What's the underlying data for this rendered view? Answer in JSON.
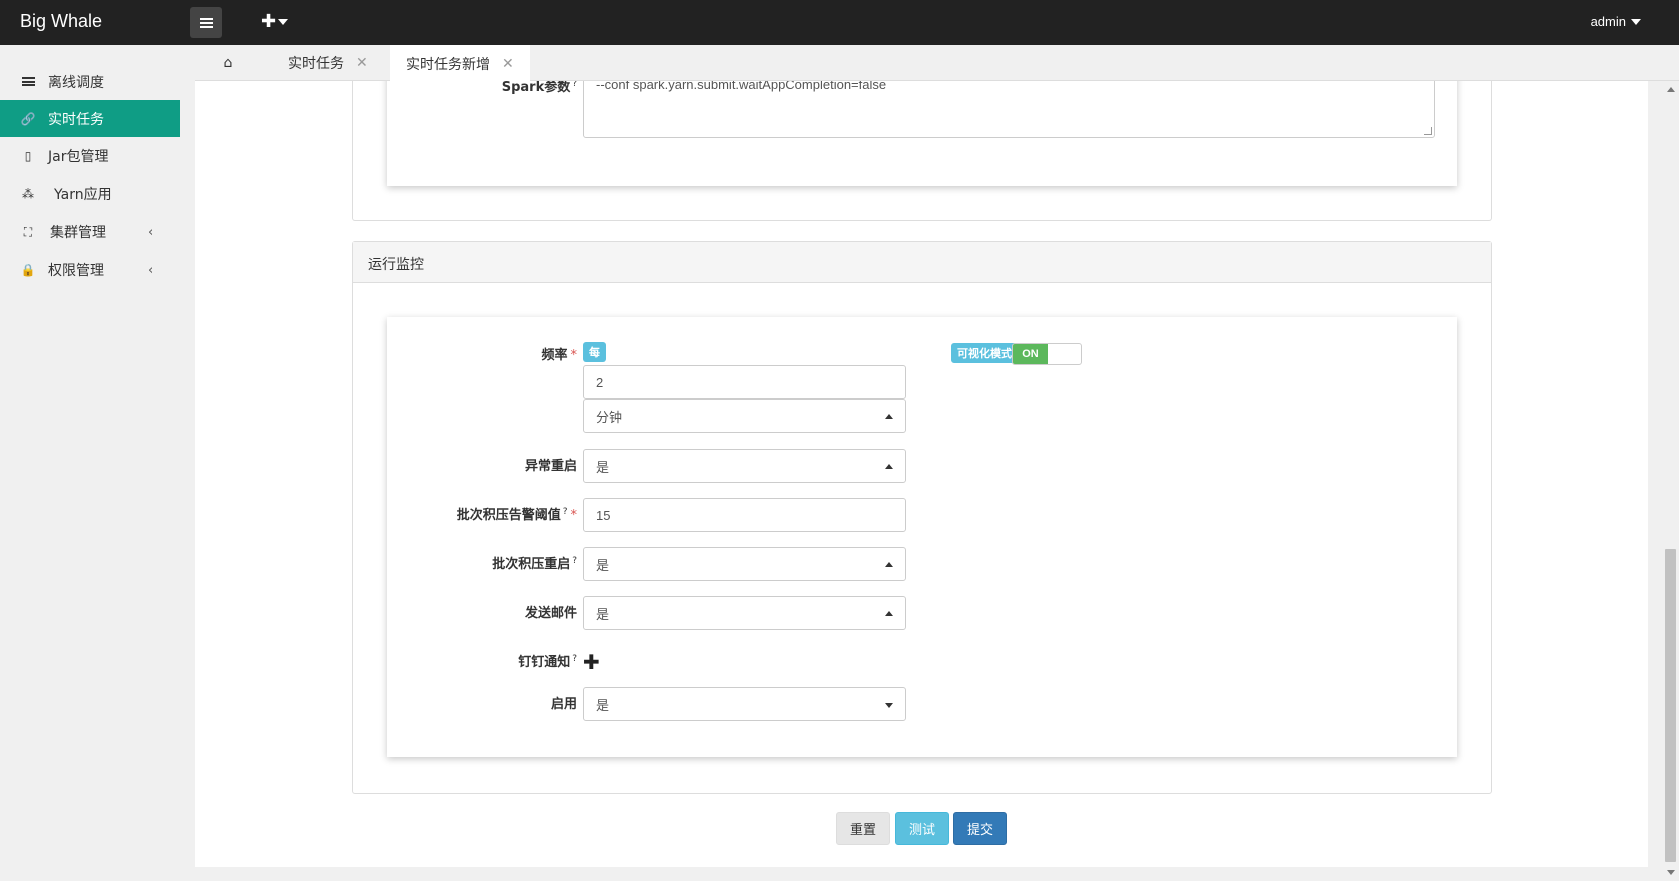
{
  "app": {
    "title": "Big Whale"
  },
  "topbar": {
    "user": "admin"
  },
  "sidebar": {
    "items": [
      {
        "label": "离线调度",
        "icon": "list-icon",
        "active": false
      },
      {
        "label": "实时任务",
        "icon": "link-icon",
        "active": true
      },
      {
        "label": "Jar包管理",
        "icon": "file-icon",
        "active": false
      },
      {
        "label": "Yarn应用",
        "icon": "cubes-icon",
        "active": false
      },
      {
        "label": "集群管理",
        "icon": "cluster-icon",
        "active": false,
        "expandable": true
      },
      {
        "label": "权限管理",
        "icon": "lock-icon",
        "active": false,
        "expandable": true
      }
    ]
  },
  "tabs": [
    {
      "label": "实时任务",
      "closable": true
    },
    {
      "label": "实时任务新增",
      "closable": true,
      "active": true
    }
  ],
  "form": {
    "spark_params": {
      "label": "Spark参数",
      "help": "?",
      "value": "--conf spark.yarn.submit.waitAppCompletion=false"
    },
    "monitor_section": {
      "title": "运行监控"
    },
    "frequency": {
      "label": "频率",
      "required": "*",
      "every_badge": "每",
      "value": "2",
      "unit": "分钟",
      "visual_mode_badge": "可视化模式",
      "toggle": "ON"
    },
    "restart_on_error": {
      "label": "异常重启",
      "value": "是"
    },
    "backlog_threshold": {
      "label": "批次积压告警阈值",
      "help": "?",
      "required": "*",
      "value": "15"
    },
    "backlog_restart": {
      "label": "批次积压重启",
      "help": "?",
      "value": "是"
    },
    "send_email": {
      "label": "发送邮件",
      "value": "是"
    },
    "dingtalk": {
      "label": "钉钉通知",
      "help": "?"
    },
    "enabled": {
      "label": "启用",
      "value": "是"
    }
  },
  "buttons": {
    "reset": "重置",
    "test": "测试",
    "submit": "提交"
  },
  "colors": {
    "primary": "#337ab7",
    "info": "#5bc0de",
    "success": "#5cb85c",
    "active_nav": "#0f9d85",
    "danger": "#d9534f"
  }
}
